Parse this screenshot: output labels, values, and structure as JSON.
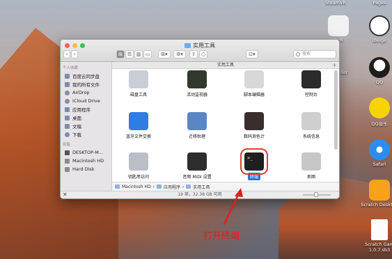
{
  "desktop": {
    "top_labels": [
      "SteamVR",
      "Pages"
    ],
    "items": [
      {
        "label": "DVR",
        "color": "#f2f2f2"
      },
      {
        "label": "iBeige",
        "color": "#ffffff"
      },
      {
        "label": "nder",
        "color": "#e8e8e8"
      },
      {
        "label": "QQ",
        "color": "#1d1d1d"
      },
      {
        "label": "QQ音乐",
        "color": "#f6d400"
      },
      {
        "label": "Safari",
        "color": "#2c8cf0"
      },
      {
        "label": "Scratch Desktop",
        "color": "#f7a21a"
      },
      {
        "label": "Scratch Gam\n1.0.7.sb3",
        "color": "#fdfdfd"
      }
    ]
  },
  "window": {
    "title": "实用工具",
    "path_header": "实用工具",
    "search_placeholder": "搜索",
    "toolbar": {
      "back": "‹",
      "forward": "›",
      "view_icon": "⊞",
      "view_list": "☰",
      "view_column": "▥",
      "view_cover": "▭",
      "arrange": "⊞▾",
      "action": "⚙▾",
      "share": "⇧",
      "tags": "○",
      "share2": "⊡▾"
    },
    "sidebar": {
      "favorites_header": "个人收藏",
      "favorites": [
        {
          "label": "百度云同步盘",
          "icon": "cloud-folder-icon"
        },
        {
          "label": "我的所有文件",
          "icon": "all-files-icon"
        },
        {
          "label": "AirDrop",
          "icon": "airdrop-icon"
        },
        {
          "label": "iCloud Drive",
          "icon": "icloud-icon"
        },
        {
          "label": "应用程序",
          "icon": "applications-icon"
        },
        {
          "label": "桌面",
          "icon": "desktop-icon"
        },
        {
          "label": "文稿",
          "icon": "documents-icon"
        },
        {
          "label": "下载",
          "icon": "downloads-icon"
        }
      ],
      "devices_header": "设备",
      "devices": [
        {
          "label": "DESKTOP-M...",
          "icon": "computer-icon"
        },
        {
          "label": "Macintosh HD",
          "icon": "disk-icon"
        },
        {
          "label": "Hard Disk",
          "icon": "disk-icon"
        }
      ]
    },
    "apps": [
      {
        "label": "磁盘工具",
        "icon": "disk-utility-icon",
        "color": "#c9ced6"
      },
      {
        "label": "活动监视器",
        "icon": "activity-monitor-icon",
        "color": "#2f3a2c"
      },
      {
        "label": "脚本编辑器",
        "icon": "script-editor-icon",
        "color": "#d8d8d8"
      },
      {
        "label": "控制台",
        "icon": "console-icon",
        "color": "#2b2b2b"
      },
      {
        "label": "蓝牙文件交换",
        "icon": "bluetooth-icon",
        "color": "#2f7de0"
      },
      {
        "label": "迁移助理",
        "icon": "migration-icon",
        "color": "#5b86c5"
      },
      {
        "label": "数码测色计",
        "icon": "color-meter-icon",
        "color": "#3a2d2d"
      },
      {
        "label": "系统信息",
        "icon": "system-info-icon",
        "color": "#cfcfcf"
      },
      {
        "label": "钥匙串访问",
        "icon": "keychain-icon",
        "color": "#b9bec7"
      },
      {
        "label": "音频 MIDI 设置",
        "icon": "midi-icon",
        "color": "#2d2d2d"
      },
      {
        "label": "终端",
        "icon": "terminal-icon",
        "color": "#1f1f1f",
        "selected": true
      },
      {
        "label": "抓图",
        "icon": "grab-icon",
        "color": "#c7c7c7"
      }
    ],
    "pathbar": [
      "Macintosh HD",
      "应用程序",
      "实用工具"
    ],
    "status": "19 项，32.38 GB 可用"
  },
  "annotation": "打开终端",
  "colors": {
    "annotation": "#e11d1d",
    "selection": "#2e72d9"
  }
}
